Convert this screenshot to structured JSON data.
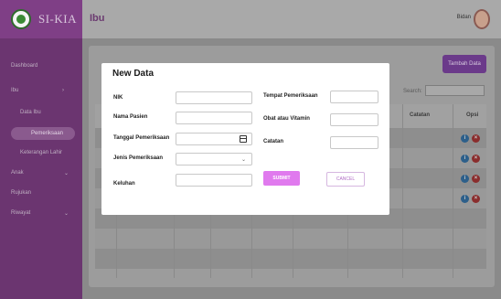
{
  "header": {
    "brand": "SI-KIA",
    "page_title": "Ibu",
    "user_name": "Bidan"
  },
  "sidebar": {
    "items": [
      {
        "label": "Dashboard"
      },
      {
        "label": "Ibu"
      },
      {
        "label": "Data Ibu"
      },
      {
        "label": "Pemeriksaan",
        "active": true
      },
      {
        "label": "Keterangan Lahir"
      },
      {
        "label": "Anak"
      },
      {
        "label": "Rujukan"
      },
      {
        "label": "Riwayat"
      }
    ]
  },
  "main": {
    "add_button": "Tambah Data",
    "search_label": "Search:",
    "table_headers": [
      "Catatan",
      "Opsi"
    ]
  },
  "modal": {
    "title": "New Data",
    "fields": {
      "nik": {
        "label": "NIK",
        "value": ""
      },
      "nama_pasien": {
        "label": "Nama Pasien",
        "value": ""
      },
      "tanggal": {
        "label": "Tanggal Pemeriksaan",
        "value": ""
      },
      "jenis": {
        "label": "Jenis Pemeriksaan",
        "value": ""
      },
      "keluhan": {
        "label": "Keluhan",
        "value": ""
      },
      "tempat": {
        "label": "Tempat Pemeriksaan",
        "value": ""
      },
      "obat": {
        "label": "Obat atau Vitamin",
        "value": ""
      },
      "catatan": {
        "label": "Catatan",
        "value": ""
      }
    },
    "submit_label": "SUBMIT",
    "cancel_label": "CANCEL"
  },
  "colors": {
    "brand": "#7f3f86",
    "submit": "#e07aee",
    "cancel_text": "#b06cc4"
  }
}
